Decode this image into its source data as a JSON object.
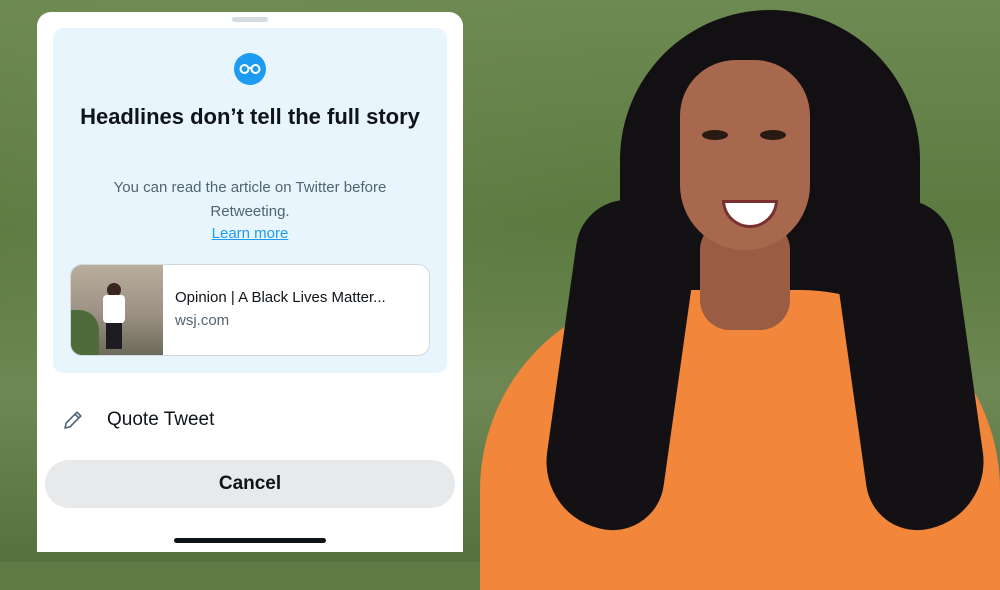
{
  "promo": {
    "title": "Headlines don’t tell the full story",
    "body": "You can read the article on Twitter before Retweeting.",
    "learn_more": "Learn more"
  },
  "card": {
    "title": "Opinion | A Black Lives Matter...",
    "domain": "wsj.com"
  },
  "actions": {
    "quote_tweet": "Quote Tweet",
    "cancel": "Cancel"
  },
  "icons": {
    "promo": "glasses-icon",
    "quote": "pencil-icon"
  },
  "colors": {
    "accent": "#1d9bf0",
    "promo_bg": "#e8f5fd",
    "shirt": "#f2873b",
    "cancel_bg": "#e7e9ea"
  }
}
